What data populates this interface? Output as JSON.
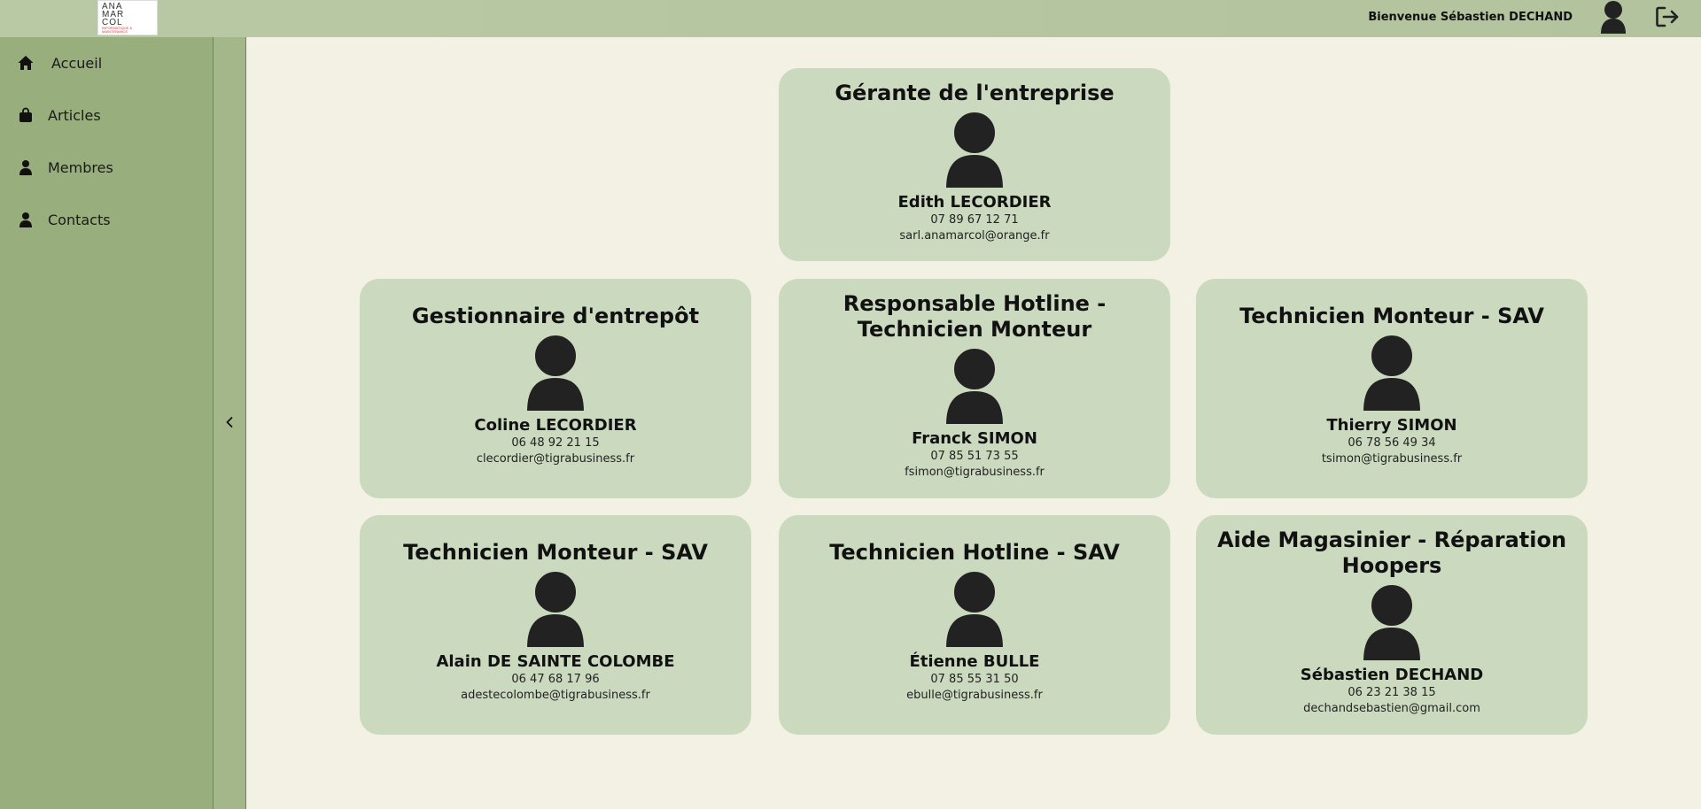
{
  "header": {
    "logo_lines": [
      "ANA",
      "MAR",
      "COL"
    ],
    "logo_tagline": "INFORMATIQUE & MAINTENANCE",
    "welcome_text": "Bienvenue Sébastien DECHAND",
    "icons": {
      "avatar": "user-icon",
      "logout": "logout-icon"
    }
  },
  "sidebar": {
    "items": [
      {
        "label": "Accueil",
        "icon": "home-icon"
      },
      {
        "label": "Articles",
        "icon": "shopping-bag-icon"
      },
      {
        "label": "Membres",
        "icon": "user-icon"
      },
      {
        "label": "Contacts",
        "icon": "user-icon"
      }
    ],
    "collapse_icon": "chevron-left-icon"
  },
  "members": [
    {
      "role": "Gérante de l'entreprise",
      "name": "Edith LECORDIER",
      "phone": "07 89 67 12 71",
      "email": "sarl.anamarcol@orange.fr"
    },
    {
      "role": "Gestionnaire d'entrepôt",
      "name": "Coline LECORDIER",
      "phone": "06 48 92 21 15",
      "email": "clecordier@tigrabusiness.fr"
    },
    {
      "role": "Responsable Hotline - Technicien Monteur",
      "name": "Franck SIMON",
      "phone": "07 85 51 73 55",
      "email": "fsimon@tigrabusiness.fr"
    },
    {
      "role": "Technicien Monteur - SAV",
      "name": "Thierry SIMON",
      "phone": "06 78 56 49 34",
      "email": "tsimon@tigrabusiness.fr"
    },
    {
      "role": "Technicien Monteur - SAV",
      "name": "Alain DE SAINTE COLOMBE",
      "phone": "06 47 68 17 96",
      "email": "adestecolombe@tigrabusiness.fr"
    },
    {
      "role": "Technicien Hotline - SAV",
      "name": "Étienne BULLE",
      "phone": "07 85 55 31 50",
      "email": "ebulle@tigrabusiness.fr"
    },
    {
      "role": "Aide Magasinier - Réparation Hoopers",
      "name": "Sébastien DECHAND",
      "phone": "06 23 21 38 15",
      "email": "dechandsebastien@gmail.com"
    }
  ],
  "colors": {
    "header_bg": "#b5c6a0",
    "sidebar_bg": "#98ae7c",
    "page_bg": "#f3f1e3",
    "card_bg": "#cbd9bf",
    "icon_dark": "#222222"
  }
}
